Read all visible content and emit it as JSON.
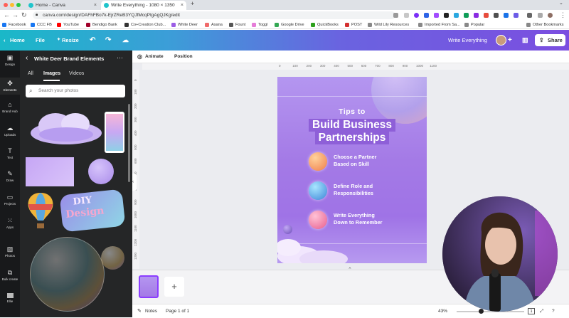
{
  "browser": {
    "tabs": [
      {
        "title": "Home - Canva",
        "active": false
      },
      {
        "title": "Write Everything - 1080 × 1350",
        "active": true
      }
    ],
    "url": "canva.com/design/DAFhFBo7k-EjrZReB3YQJfMcqPtgAgQJKg/edit",
    "bookmarks": [
      {
        "label": "Facebook",
        "color": "#1877f2"
      },
      {
        "label": "CCC FB",
        "color": "#1877f2"
      },
      {
        "label": "YouTube",
        "color": "#ff0000"
      },
      {
        "label": "Bendigo Bank",
        "color": "#a0002a"
      },
      {
        "label": "Co+Creation Club...",
        "color": "#333333"
      },
      {
        "label": "White Deer",
        "color": "#9b5de5"
      },
      {
        "label": "Asana",
        "color": "#f06a6a"
      },
      {
        "label": "Fount",
        "color": "#555555"
      },
      {
        "label": "Toggl",
        "color": "#e57cd8"
      },
      {
        "label": "Google Drive",
        "color": "#34a853"
      },
      {
        "label": "QuickBooks",
        "color": "#2ca01c"
      },
      {
        "label": "POST",
        "color": "#d32f2f"
      },
      {
        "label": "Wild Lily Resources",
        "color": "#888888"
      },
      {
        "label": "Imported From Sa...",
        "color": "#888888"
      },
      {
        "label": "Popular",
        "color": "#888888"
      }
    ],
    "other_bookmarks": "Other Bookmarks"
  },
  "header": {
    "home": "Home",
    "file": "File",
    "resize": "Resize",
    "doc_title": "Write Everything",
    "share": "Share"
  },
  "rail": [
    {
      "label": "Design",
      "icon": "design-icon"
    },
    {
      "label": "Elements",
      "icon": "elements-icon"
    },
    {
      "label": "Brand Hub",
      "icon": "brand-hub-icon"
    },
    {
      "label": "Uploads",
      "icon": "uploads-icon"
    },
    {
      "label": "Text",
      "icon": "text-icon"
    },
    {
      "label": "Draw",
      "icon": "draw-icon"
    },
    {
      "label": "Projects",
      "icon": "projects-icon"
    },
    {
      "label": "Apps",
      "icon": "apps-icon"
    },
    {
      "label": "Photos",
      "icon": "photos-icon"
    },
    {
      "label": "Bulk create",
      "icon": "bulk-create-icon"
    },
    {
      "label": "Ellie",
      "icon": "ellie-icon"
    }
  ],
  "panel": {
    "title": "White Deer Brand Elements",
    "tabs": [
      "All",
      "Images",
      "Videos"
    ],
    "active_tab": "Images",
    "search_placeholder": "Search your photos",
    "thumb_text_1": "DIY",
    "thumb_text_2": "Design"
  },
  "editor": {
    "animate": "Animate",
    "position": "Position",
    "ruler_ticks": [
      "0",
      "100",
      "200",
      "300",
      "400",
      "500",
      "600",
      "700",
      "800",
      "900",
      "1000",
      "1100"
    ],
    "ruler_left_ticks": [
      "0",
      "100",
      "200",
      "300",
      "400",
      "500",
      "600",
      "700",
      "800",
      "900",
      "1000",
      "1100",
      "1200",
      "1300"
    ]
  },
  "design": {
    "kicker": "Tips to",
    "title_line1": "Build Business",
    "title_line2": "Partnerships",
    "items": [
      {
        "line1": "Choose a Partner",
        "line2": "Based on Skill",
        "color": "#f09a5a"
      },
      {
        "line1": "Define Role and",
        "line2": "Responsibilities",
        "color": "#4fa4d8"
      },
      {
        "line1": "Write Everything",
        "line2": "Down to Remember",
        "color": "#f07aa0"
      }
    ]
  },
  "bottom": {
    "notes": "Notes",
    "page": "Page 1 of 1",
    "zoom": "43%",
    "page_count": "1"
  }
}
